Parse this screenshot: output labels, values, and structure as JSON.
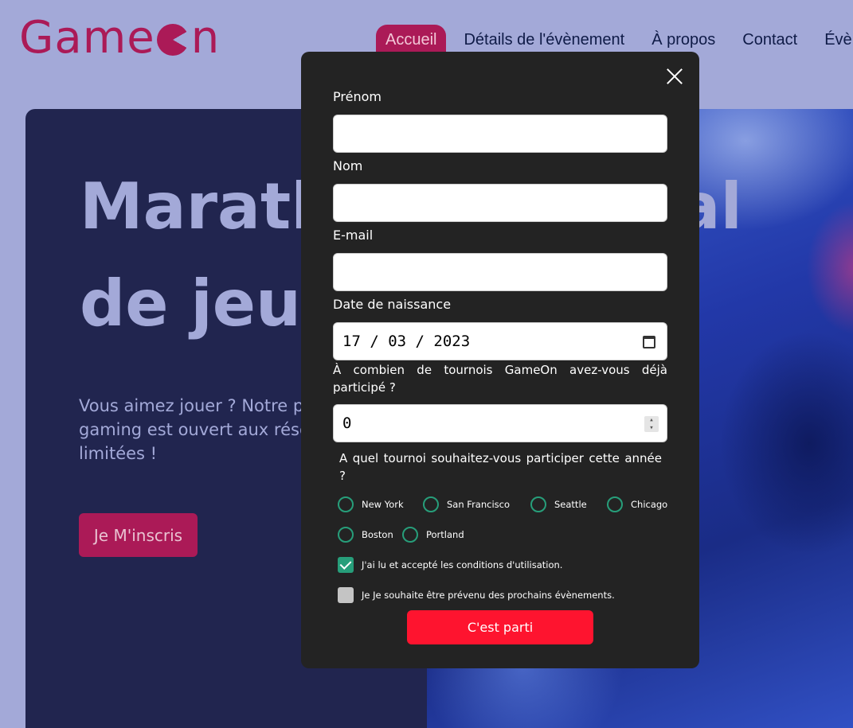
{
  "logo": {
    "part1": "Game",
    "part2": "n"
  },
  "nav": {
    "items": [
      {
        "label": "Accueil"
      },
      {
        "label": "Détails de l'évènement"
      },
      {
        "label": "À propos"
      },
      {
        "label": "Contact"
      },
      {
        "label": "Évè"
      }
    ],
    "active_index": 0
  },
  "hero": {
    "title": "Marathon national\nde jeux vidéos",
    "text": "Vous aimez jouer ? Notre prochain évènement gaming est ouvert aux réservations... Places limitées !",
    "button_label": "Je M'inscris"
  },
  "modal": {
    "fields": {
      "first_name": {
        "label": "Prénom",
        "value": ""
      },
      "last_name": {
        "label": "Nom",
        "value": ""
      },
      "email": {
        "label": "E-mail",
        "value": ""
      },
      "birthdate": {
        "label": "Date de naissance",
        "value": "17 / 03 / 2023"
      },
      "tournaments_count": {
        "label": "À combien de tournois GameOn avez-vous déjà participé ?",
        "value": "0"
      }
    },
    "location_question": "A quel tournoi souhaitez-vous participer cette année ?",
    "locations": [
      "New York",
      "San Francisco",
      "Seattle",
      "Chicago",
      "Boston",
      "Portland"
    ],
    "terms": {
      "label": "J'ai lu et accepté les conditions d'utilisation.",
      "checked": true
    },
    "newsletter": {
      "label": "Je Je souhaite être prévenu des prochains évènements.",
      "checked": false
    },
    "submit_label": "C'est parti"
  },
  "colors": {
    "page_bg": "#a3a9d8",
    "brand": "#ab1a57",
    "hero_bg": "#21254f",
    "modal_bg": "#232323",
    "radio_accent": "#279e7a",
    "submit": "#fe142f"
  }
}
